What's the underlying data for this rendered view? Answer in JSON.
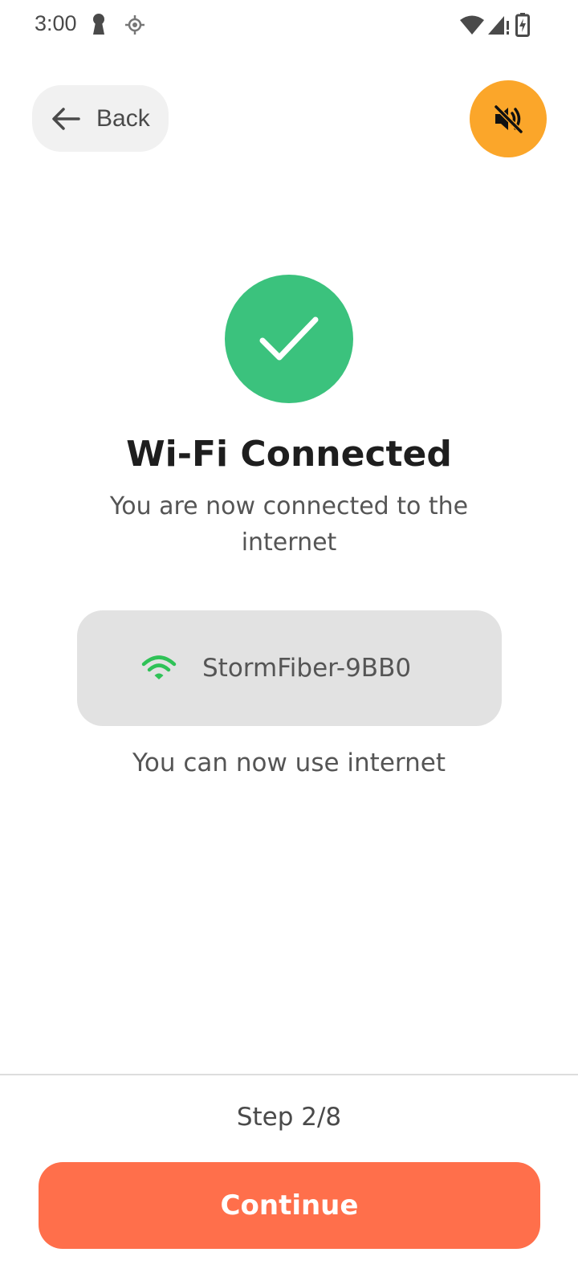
{
  "status_bar": {
    "time": "3:00",
    "icons": [
      "keyhole-icon",
      "location-icon",
      "wifi-signal-icon",
      "cell-signal-icon",
      "battery-charging-icon"
    ]
  },
  "header": {
    "back_label": "Back",
    "back_icon": "arrow-left-icon",
    "mute_icon": "volume-off-icon"
  },
  "main": {
    "success_icon": "check-icon",
    "title": "Wi-Fi Connected",
    "subtitle": "You are now connected to the internet",
    "network": {
      "icon": "wifi-icon",
      "name": "StormFiber-9BB0"
    },
    "note": "You can now use internet"
  },
  "footer": {
    "step": "Step 2/8",
    "continue_label": "Continue"
  },
  "colors": {
    "mute_button": "#fba62a",
    "success": "#3bc27d",
    "wifi_icon": "#2fc257",
    "continue_button": "#ff6f4b",
    "card_background": "#e2e2e2"
  }
}
